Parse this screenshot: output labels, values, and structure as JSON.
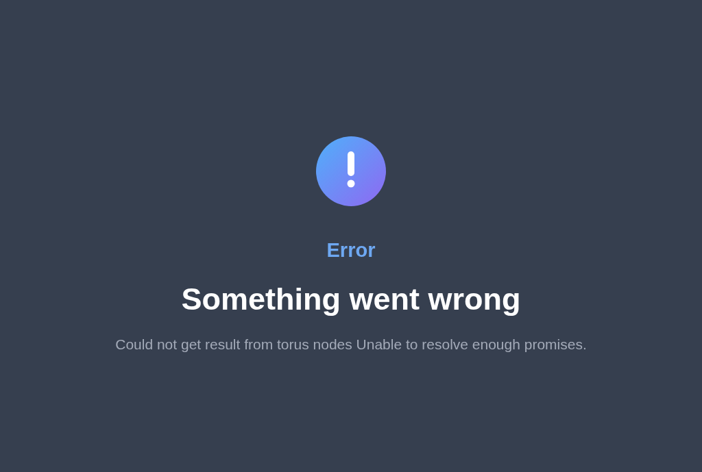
{
  "error": {
    "label": "Error",
    "title": "Something went wrong",
    "message": "Could not get result from torus nodes Unable to resolve enough promises."
  }
}
